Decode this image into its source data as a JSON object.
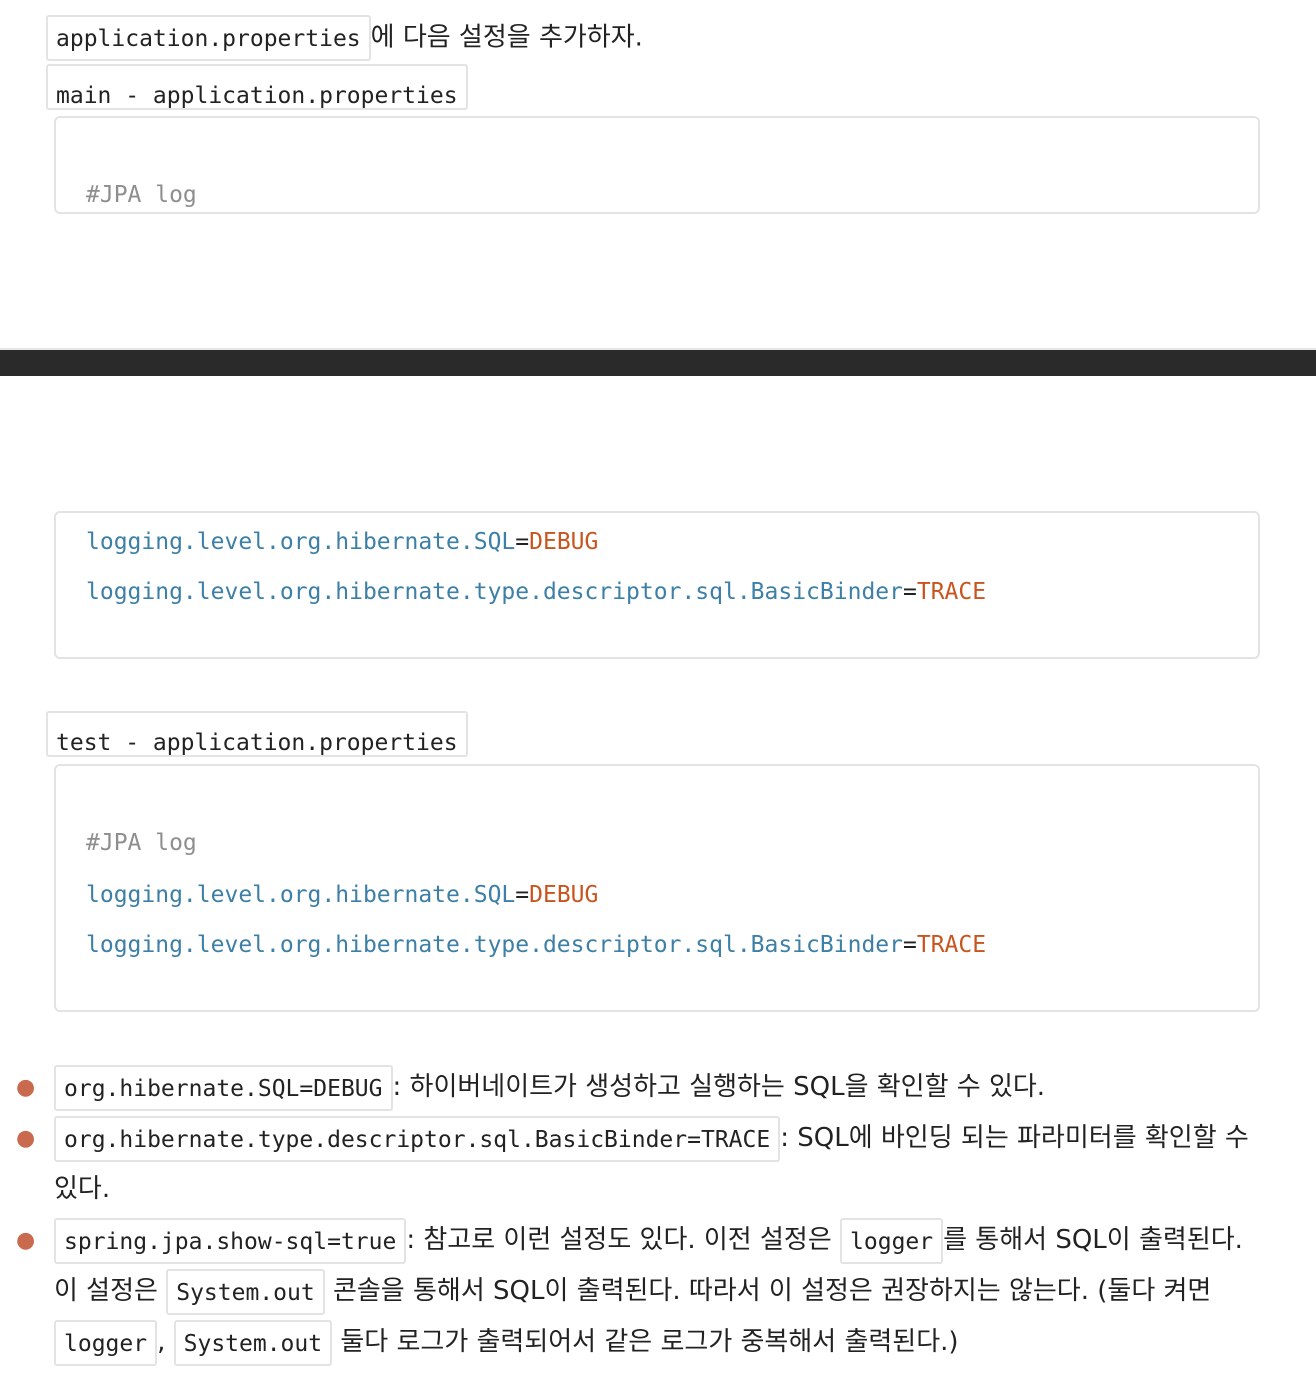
{
  "intro": {
    "code": "application.properties",
    "text": "에 다음 설정을 추가하자."
  },
  "main_block": {
    "label": "main - application.properties",
    "comment": "#JPA log",
    "lines": [
      {
        "key": "logging.level.org.hibernate.SQL",
        "eq": "=",
        "value": "DEBUG"
      },
      {
        "key": "logging.level.org.hibernate.type.descriptor.sql.BasicBinder",
        "eq": "=",
        "value": "TRACE"
      }
    ]
  },
  "test_block": {
    "label": "test - application.properties",
    "comment": "#JPA log",
    "lines": [
      {
        "key": "logging.level.org.hibernate.SQL",
        "eq": "=",
        "value": "DEBUG"
      },
      {
        "key": "logging.level.org.hibernate.type.descriptor.sql.BasicBinder",
        "eq": "=",
        "value": "TRACE"
      }
    ]
  },
  "bullets": [
    {
      "code": "org.hibernate.SQL=DEBUG",
      "text": ": 하이버네이트가 생성하고 실행하는 SQL을 확인할 수 있다."
    },
    {
      "code": "org.hibernate.type.descriptor.sql.BasicBinder=TRACE",
      "text": ": SQL에 바인딩 되는 파라미터를 확인할 수 있다."
    },
    {
      "code": "spring.jpa.show-sql=true",
      "text1": ": 참고로 이런 설정도 있다. 이전 설정은 ",
      "code2": "logger",
      "text2": "를 통해서 SQL이 출력된다. 이 설정은 ",
      "code3": "System.out",
      "text3": " 콘솔을 통해서 SQL이 출력된다. 따라서 이 설정은 권장하지는 않는다. (둘다 켜면 ",
      "code4": "logger",
      "text4": ", ",
      "code5": "System.out",
      "text5": " 둘다 로그가 출력되어서 같은 로그가 중복해서 출력된다.)"
    }
  ],
  "colors": {
    "key": "#3d7fa6",
    "value": "#c9551e",
    "comment": "#8e8e8e",
    "bullet": "#c9694d",
    "bar": "#2a2a2a"
  }
}
